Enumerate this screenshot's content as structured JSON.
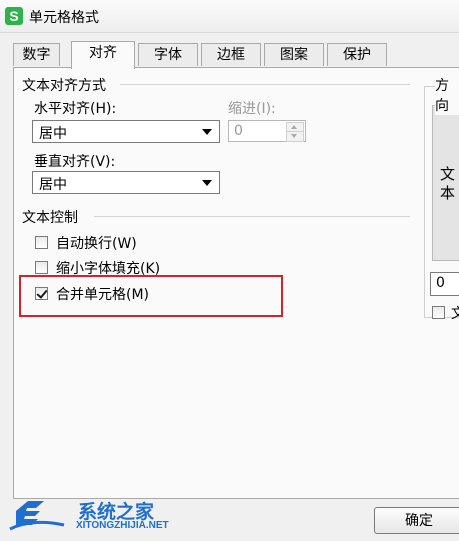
{
  "window": {
    "title": "单元格格式",
    "icon": "wps-spreadsheet-icon",
    "icon_letter": "S"
  },
  "tabs": [
    {
      "label": "数字",
      "active": false
    },
    {
      "label": "对齐",
      "active": true
    },
    {
      "label": "字体",
      "active": false
    },
    {
      "label": "边框",
      "active": false
    },
    {
      "label": "图案",
      "active": false
    },
    {
      "label": "保护",
      "active": false
    }
  ],
  "alignment": {
    "section_title": "文本对齐方式",
    "horizontal_label": "水平对齐(H):",
    "horizontal_value": "居中",
    "indent_label": "缩进(I):",
    "indent_value": "0",
    "vertical_label": "垂直对齐(V):",
    "vertical_value": "居中"
  },
  "text_control": {
    "section_title": "文本控制",
    "wrap_text": {
      "label": "自动换行(W)",
      "checked": false
    },
    "shrink_to_fit": {
      "label": "缩小字体填充(K)",
      "checked": false
    },
    "merge_cells": {
      "label": "合并单元格(M)",
      "checked": true
    }
  },
  "orientation": {
    "section_title": "方向",
    "text_chars": [
      "文",
      "本"
    ],
    "degrees_value": "0",
    "partial_checkbox_label": "文"
  },
  "buttons": {
    "ok": "确定"
  },
  "watermark": {
    "brand": "系统之家",
    "url": "XITONGZHIJIA.NET"
  },
  "colors": {
    "highlight": "#d9202a",
    "app_icon": "#2eb24a",
    "watermark_blue": "#1f6fd1"
  }
}
